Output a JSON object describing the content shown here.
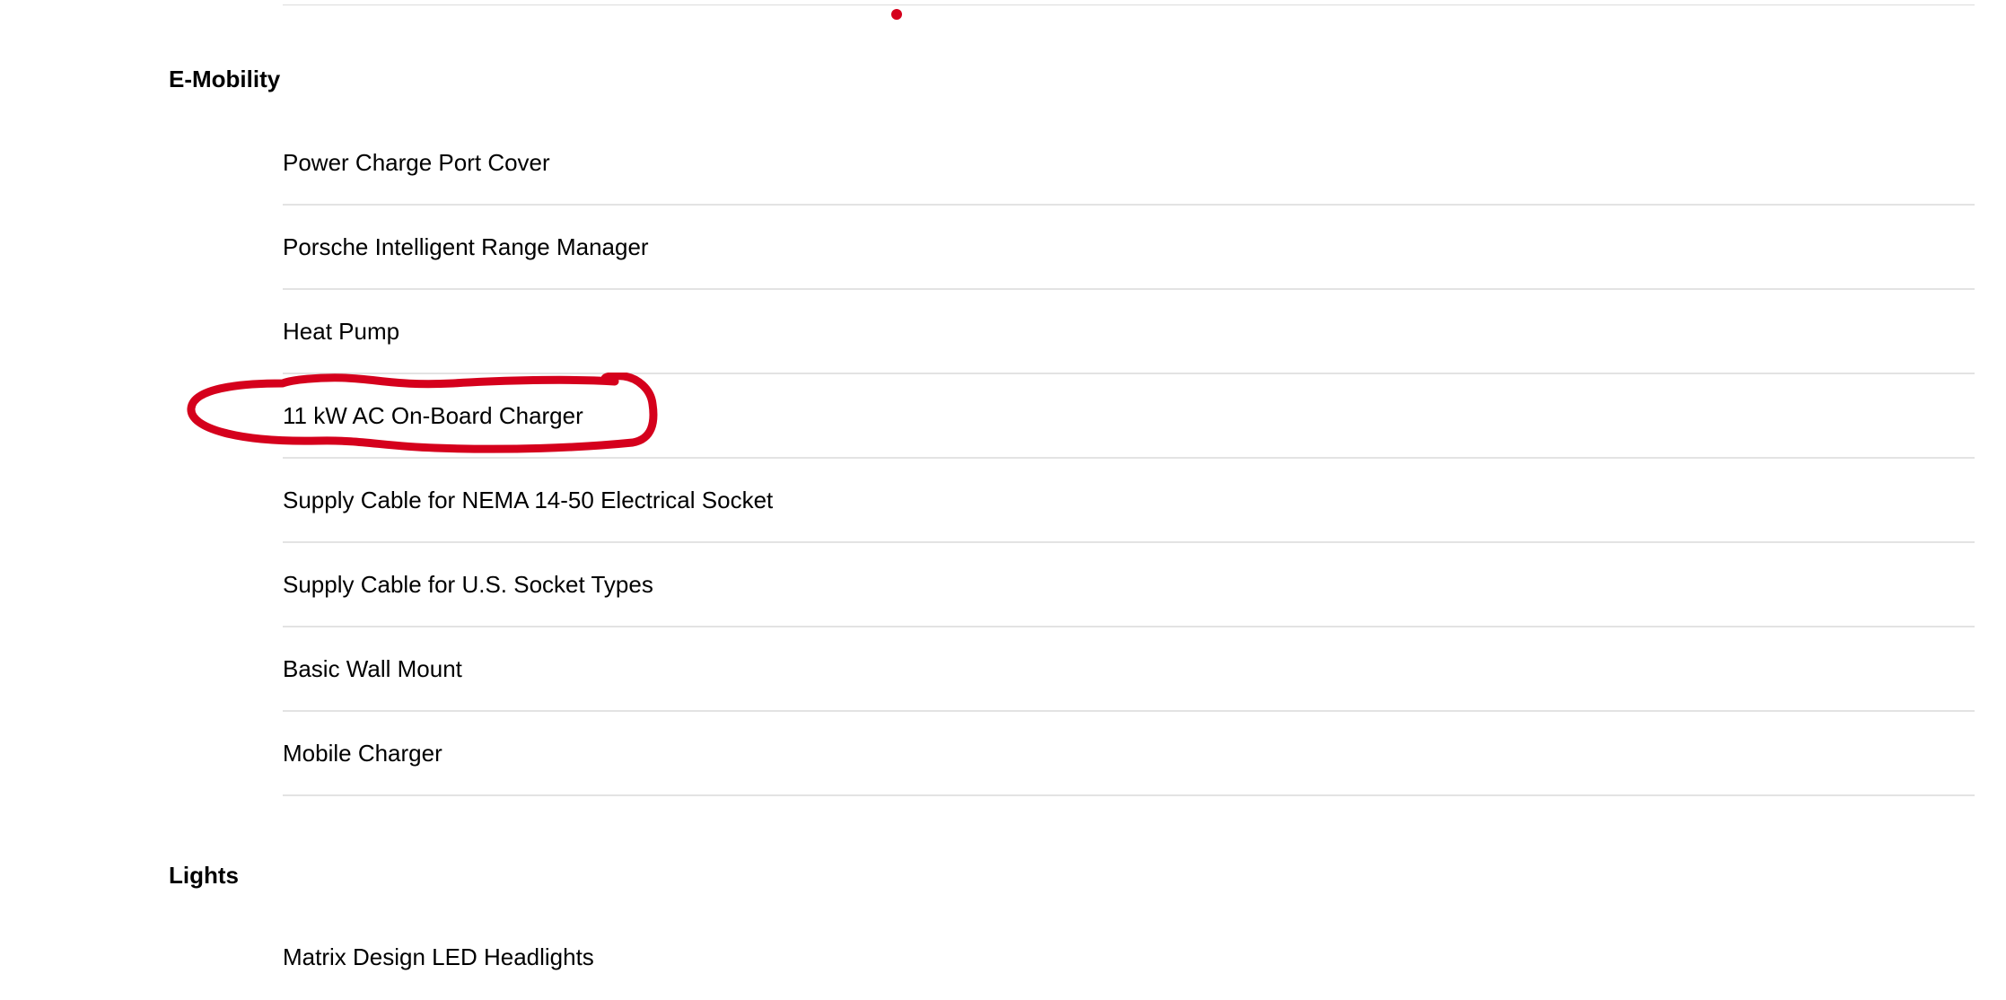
{
  "sections": [
    {
      "title": "E-Mobility",
      "items": [
        {
          "label": "Power Charge Port Cover"
        },
        {
          "label": "Porsche Intelligent Range Manager"
        },
        {
          "label": "Heat Pump"
        },
        {
          "label": "11 kW AC On-Board Charger"
        },
        {
          "label": "Supply Cable for NEMA 14-50 Electrical Socket"
        },
        {
          "label": "Supply Cable for U.S. Socket Types"
        },
        {
          "label": "Basic Wall Mount"
        },
        {
          "label": "Mobile Charger"
        }
      ]
    },
    {
      "title": "Lights",
      "items": [
        {
          "label": "Matrix Design LED Headlights"
        }
      ]
    }
  ],
  "annotation": {
    "type": "hand-drawn-circle",
    "color": "#d5001c",
    "target": "11 kW AC On-Board Charger"
  },
  "accent_color": "#d5001c"
}
